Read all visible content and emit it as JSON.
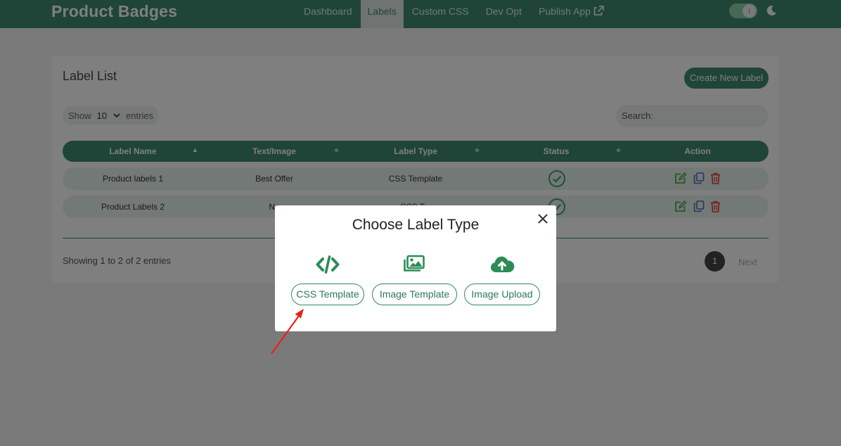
{
  "header": {
    "brand": "Product Badges",
    "nav": [
      {
        "label": "Dashboard"
      },
      {
        "label": "Labels"
      },
      {
        "label": "Custom CSS"
      },
      {
        "label": "Dev Opt"
      },
      {
        "label": "Publish App"
      }
    ],
    "active_nav": "Labels",
    "theme_toggle_on": true
  },
  "card": {
    "title": "Label List",
    "create_button": "Create New Label",
    "show_label": "Show",
    "entries_value": "10",
    "entries_label": "entries",
    "search_label": "Search:",
    "columns": [
      "Label Name",
      "Text/Image",
      "Label Type",
      "Status",
      "Action"
    ],
    "rows": [
      {
        "name": "Product labels 1",
        "text": "Best Offer",
        "type": "CSS Template"
      },
      {
        "name": "Product Labels 2",
        "text": "Ne",
        "type": "CSS T..."
      }
    ],
    "info": "Showing 1 to 2 of 2 entries",
    "current_page": "1",
    "next_label": "Next"
  },
  "modal": {
    "title": "Choose Label Type",
    "options": [
      {
        "label": "CSS Template",
        "icon": "code-icon"
      },
      {
        "label": "Image Template",
        "icon": "images-icon"
      },
      {
        "label": "Image Upload",
        "icon": "cloud-upload-icon"
      }
    ]
  },
  "colors": {
    "primary": "#3d8a70",
    "row_bg": "#e6f2ec",
    "option_green": "#2e8b57",
    "annotation_arrow": "#e8201c"
  }
}
